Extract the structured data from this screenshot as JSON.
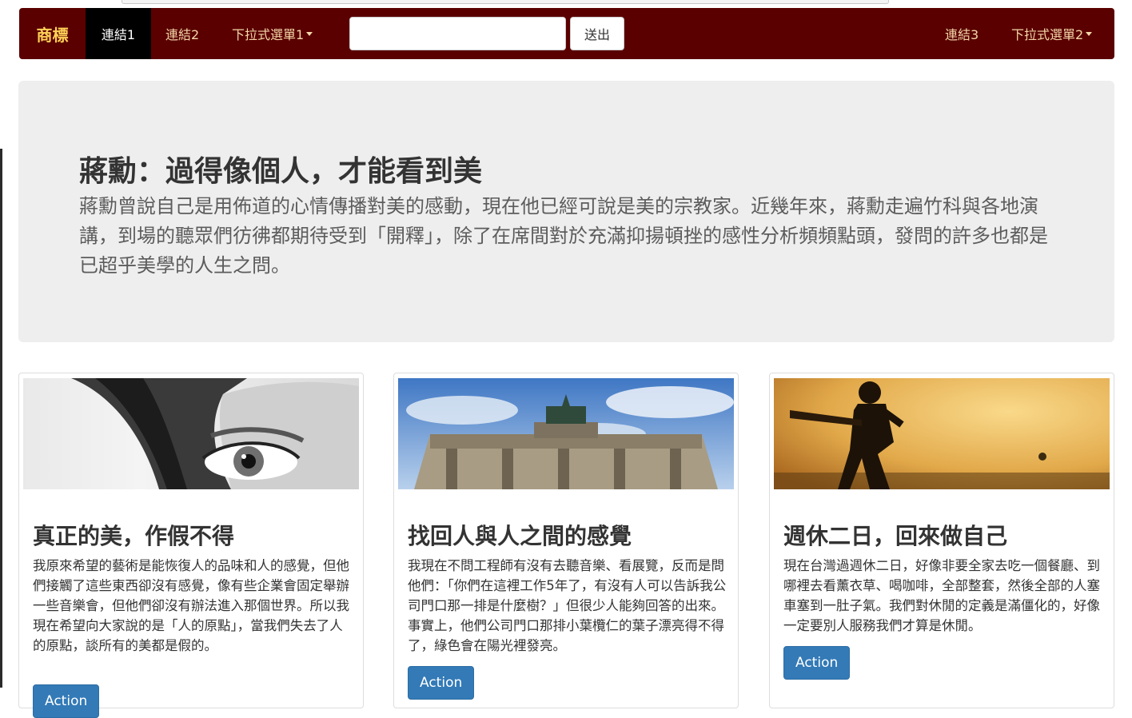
{
  "navbar": {
    "brand": "商標",
    "link1": "連結1",
    "link2": "連結2",
    "dropdown1": "下拉式選單1",
    "search_value": "",
    "submit_label": "送出",
    "link3": "連結3",
    "dropdown2": "下拉式選單2",
    "brand_color": "#ffd257",
    "bg_color": "#5a0000"
  },
  "jumbotron": {
    "title": "蔣勳：過得像個人，才能看到美",
    "text": "蔣勳曾說自己是用佈道的心情傳播對美的感動，現在他已經可說是美的宗教家。近幾年來，蔣勳走遍竹科與各地演講，到場的聽眾們彷彿都期待受到「開釋」，除了在席間對於充滿抑揚頓挫的感性分析頻頻點頭，發問的許多也都是已超乎美學的人生之問。"
  },
  "cards": [
    {
      "title": "真正的美，作假不得",
      "text": "我原來希望的藝術是能恢復人的品味和人的感覺，但他們接觸了這些東西卻沒有感覺，像有些企業會固定舉辦一些音樂會，但他們卻沒有辦法進入那個世界。所以我現在希望向大家說的是「人的原點」，當我們失去了人的原點，談所有的美都是假的。",
      "button": "Action"
    },
    {
      "title": "找回人與人之間的感覺",
      "text": "我現在不問工程師有沒有去聽音樂、看展覽，反而是問他們：「你們在這裡工作5年了，有沒有人可以告訴我公司門口那一排是什麼樹？」但很少人能夠回答的出來。事實上，他們公司門口那排小葉欖仁的葉子漂亮得不得了，綠色會在陽光裡發亮。",
      "button": "Action"
    },
    {
      "title": "週休二日，回來做自己",
      "text": "現在台灣過週休二日，好像非要全家去吃一個餐廳、到哪裡去看薰衣草、喝咖啡，全部整套，然後全部的人塞車塞到一肚子氣。我們對休閒的定義是滿僵化的，好像一定要別人服務我們才算是休閒。",
      "button": "Action"
    }
  ],
  "colors": {
    "primary_button": "#337ab7",
    "jumbotron_bg": "#eeeeee"
  }
}
